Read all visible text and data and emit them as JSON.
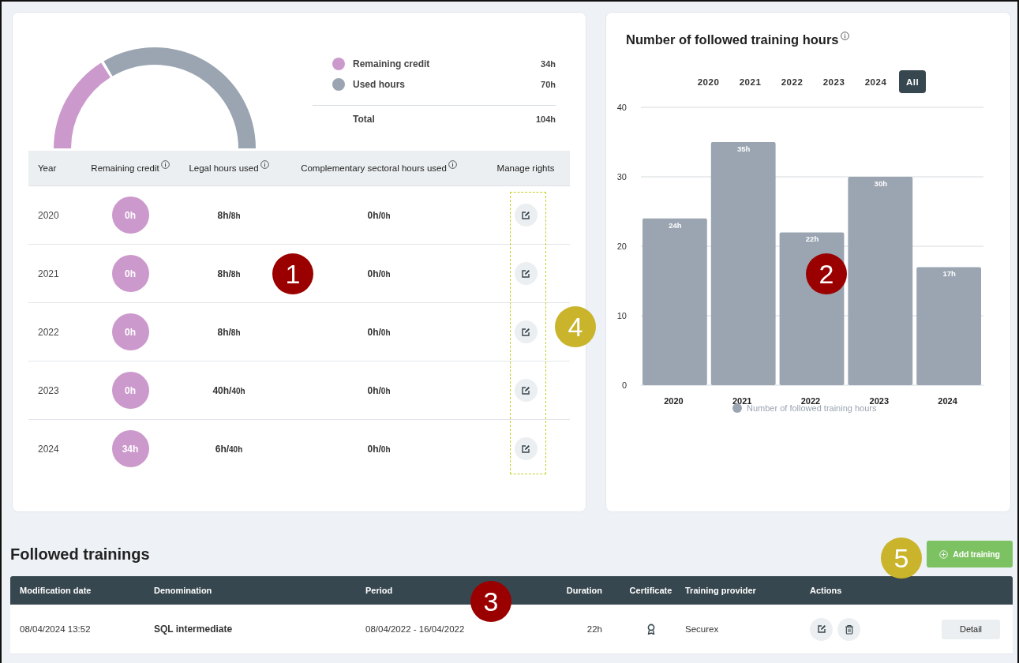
{
  "gauge": {
    "chart_data": {
      "type": "donut",
      "categories": [
        "Remaining credit",
        "Used hours"
      ],
      "series": [
        {
          "values": [
            32.7,
            67.3
          ]
        }
      ]
    },
    "legend": [
      {
        "value": "34h",
        "color": "#cc99cc"
      },
      {
        "value": "70h",
        "color": "#9aa5b1"
      }
    ],
    "total": {
      "label": "Total",
      "value": "104h"
    }
  },
  "credit_table": {
    "columns": [
      {
        "label": "Year",
        "info": false
      },
      {
        "label": "Remaining credit",
        "info": true
      },
      {
        "label": "Legal hours used",
        "info": true
      },
      {
        "label": "Complementary sectoral hours used",
        "info": true
      },
      {
        "label": "Manage rights",
        "info": false
      }
    ],
    "rows": [
      {
        "year": "2020",
        "remaining": "0h",
        "legal_used": "8h/",
        "legal_max": "8h",
        "sectoral_used": "0h/",
        "sectoral_max": "0h"
      },
      {
        "year": "2021",
        "remaining": "0h",
        "legal_used": "8h/",
        "legal_max": "8h",
        "sectoral_used": "0h/",
        "sectoral_max": "0h"
      },
      {
        "year": "2022",
        "remaining": "0h",
        "legal_used": "8h/",
        "legal_max": "8h",
        "sectoral_used": "0h/",
        "sectoral_max": "0h"
      },
      {
        "year": "2023",
        "remaining": "0h",
        "legal_used": "40h/",
        "legal_max": "40h",
        "sectoral_used": "0h/",
        "sectoral_max": "0h"
      },
      {
        "year": "2024",
        "remaining": "34h",
        "legal_used": "6h/",
        "legal_max": "40h",
        "sectoral_used": "0h/",
        "sectoral_max": "0h"
      }
    ]
  },
  "hours_chart": {
    "title": "Number of followed training hours",
    "filters": [
      {
        "label": "2020",
        "selected": false
      },
      {
        "label": "2021",
        "selected": false
      },
      {
        "label": "2022",
        "selected": false
      },
      {
        "label": "2023",
        "selected": false
      },
      {
        "label": "2024",
        "selected": false
      },
      {
        "label": "All",
        "selected": true
      }
    ],
    "chart_data": {
      "type": "bar",
      "categories": [
        "2020",
        "2021",
        "2022",
        "2023",
        "2024"
      ],
      "series": [
        {
          "name": "Number of followed training hours",
          "color": "#9aa5b1",
          "values": [
            24,
            35,
            22,
            30,
            17
          ]
        }
      ],
      "ylim": [
        0,
        40
      ],
      "yticks": [
        0,
        10,
        20,
        30,
        40
      ],
      "grid": true,
      "value_labels": [
        "24h",
        "35h",
        "22h",
        "30h",
        "17h"
      ]
    }
  },
  "followed": {
    "title": "Followed trainings",
    "add_button": "Add training",
    "columns": [
      "Modification date",
      "Denomination",
      "Period",
      "Duration",
      "Certificate",
      "Training provider",
      "Actions"
    ],
    "rows": [
      {
        "date": "08/04/2024 13:52",
        "name": "SQL intermediate",
        "period": "08/04/2022 - 16/04/2022",
        "duration": "22h",
        "certificate": true,
        "provider": "Securex",
        "detail": "Detail"
      }
    ]
  },
  "callouts": [
    {
      "label": "1",
      "color": "#9b0000"
    },
    {
      "label": "2",
      "color": "#9b0000"
    },
    {
      "label": "3",
      "color": "#9b0000"
    },
    {
      "label": "4",
      "color": "#c9b42b"
    },
    {
      "label": "5",
      "color": "#c9b42b"
    }
  ]
}
